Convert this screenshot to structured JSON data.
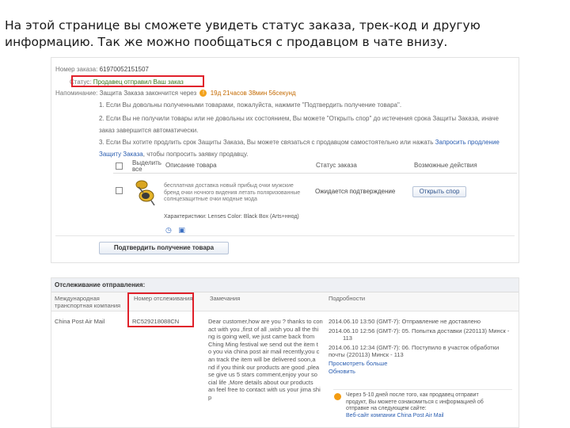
{
  "caption": "На этой странице вы сможете увидеть статус заказа, трек-код и другую информацию. Так же можно пообщаться с продавцом в чате внизу.",
  "order": {
    "number_label": "Номер заказа:",
    "number_value": "61970052151507",
    "status_label": "Статус:",
    "status_value": "Продавец отправил Ваш заказ",
    "reminder_label": "Напоминание:",
    "reminder_text": "Защита Заказа закончится через",
    "reminder_timer": "19д 21часов 38мин 56секунд",
    "tips": [
      "1. Если Вы довольны полученными товарами, пожалуйста, нажмите \"Подтвердить получение товара\".",
      "2. Если Вы не получили товары или не довольны их состоянием, Вы можете \"Открыть спор\" до истечения срока Защиты Заказа, иначе",
      "заказ завершится автоматически.",
      "3. Если Вы хотите продлить срок Защиты Заказа, Вы можете связаться с продавцом самостоятельно или нажать",
      "Защиту Заказа"
    ],
    "extend_link": "Запросить продление",
    "tip3_tail": ", чтобы попросить заявку продавцу."
  },
  "products_table": {
    "headers": [
      "Выделить все",
      "Описание товара",
      "Статус заказа",
      "Возможные действия"
    ],
    "product_description": "бесплатная доставка новый прибыд очки мужские бренд очки ночного видения летать поляризованные солнцезащитные очки модные мода",
    "product_characteristics": "Характеристики: Lenses Color: Black Box (Arts+ннод)",
    "status": "Ожидается подтверждение",
    "dispute_button": "Открыть спор",
    "confirm_button": "Подтвердить получение товара"
  },
  "tracking": {
    "section_title": "Отслеживание отправления:",
    "headers": {
      "carrier": "Международная транспортная компания",
      "tracking_number": "Номер отслеживания",
      "notes": "Замечания",
      "details": "Подробности"
    },
    "carrier": "China Post Air Mail",
    "tracking_number": "RC529218088CN",
    "notes": [
      "Dear customer,how are you ? thanks to con",
      "act with you ,first of all ,wish you all the thi",
      "ng is going well, we just came back from",
      "Ching Ming festival we send out the item t",
      "o you via china post air mail recently,you c",
      "an track the item will be delivered soon,a",
      "nd if you think our products are good ,plea",
      "se give us 5 stars comment,enjoy your so",
      "cial life ,More details about our products",
      "an feel free to contact with us your jima shi",
      "p"
    ],
    "details": [
      "2014.06.10 13:50 (GMT-7): Отправление не доставлено",
      "2014.06.10 12:56 (GMT-7): 05. Попытка доставки (220113) Минск -",
      "113",
      "2014.06.10 12:34 (GMT-7): 06. Поступило в участок обработки",
      "почты (220113) Минск - 113"
    ],
    "more_link": "Просмотреть больше",
    "refresh_link": "Обновить",
    "tip_lines": [
      "Через 5-10 дней после того, как продавец отправит",
      "продукт, Вы можете ознакомиться с информацией об",
      "отправке на следующем сайте:",
      "Веб-сайт компании China Post Air Mail"
    ]
  }
}
